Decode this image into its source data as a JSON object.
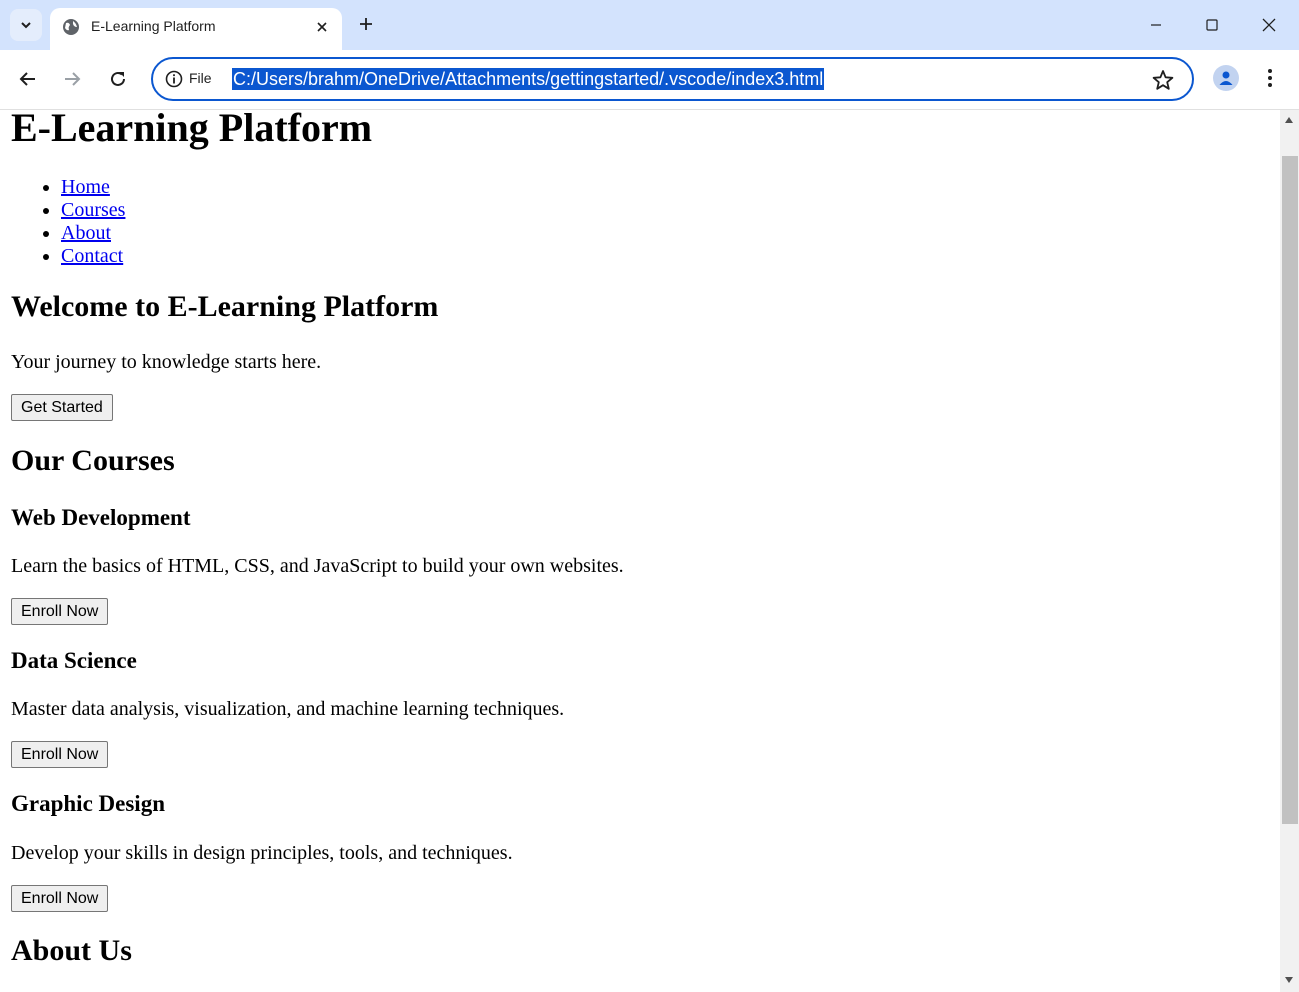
{
  "browser": {
    "tab_title": "E-Learning Platform",
    "omnibox_scheme_label": "File",
    "url": "C:/Users/brahm/OneDrive/Attachments/gettingstarted/.vscode/index3.html",
    "accent_color": "#0b57d0",
    "chrome_color": "#d3e3fd"
  },
  "page": {
    "title": "E-Learning Platform",
    "nav": [
      "Home",
      "Courses",
      "About",
      "Contact"
    ],
    "hero": {
      "heading": "Welcome to E-Learning Platform",
      "text": "Your journey to knowledge starts here.",
      "button": "Get Started"
    },
    "courses": {
      "heading": "Our Courses",
      "items": [
        {
          "title": "Web Development",
          "desc": "Learn the basics of HTML, CSS, and JavaScript to build your own websites.",
          "button": "Enroll Now"
        },
        {
          "title": "Data Science",
          "desc": "Master data analysis, visualization, and machine learning techniques.",
          "button": "Enroll Now"
        },
        {
          "title": "Graphic Design",
          "desc": "Develop your skills in design principles, tools, and techniques.",
          "button": "Enroll Now"
        }
      ]
    },
    "about": {
      "heading": "About Us"
    },
    "link_color": "#0000ee"
  }
}
